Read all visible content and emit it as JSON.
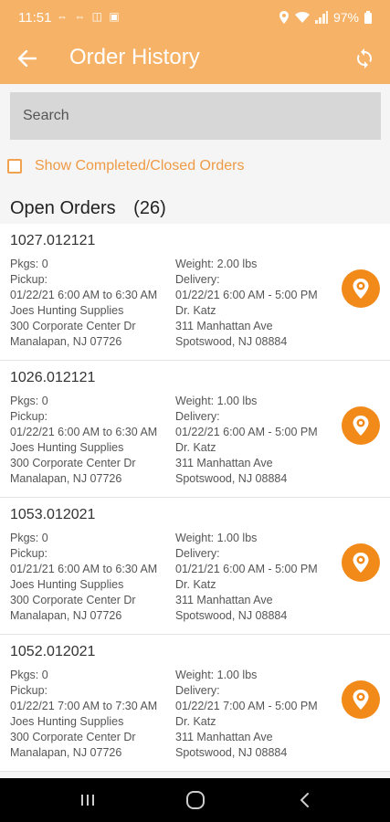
{
  "status_bar": {
    "time": "11:51",
    "left_icons": "⇔ ⇔ ◫ ▣",
    "battery": "97%"
  },
  "header": {
    "title": "Order History",
    "back_icon": "arrow-left",
    "refresh_icon": "refresh"
  },
  "search": {
    "placeholder": "Search"
  },
  "filter": {
    "show_completed_label": "Show Completed/Closed Orders",
    "checked": false
  },
  "section": {
    "title": "Open Orders",
    "count": "(26)"
  },
  "orders": [
    {
      "id": "1027.012121",
      "pkgs": "Pkgs: 0",
      "pickup_label": "Pickup:",
      "pickup_window": "01/22/21 6:00 AM to 6:30 AM",
      "pickup_name": "Joes Hunting Supplies",
      "pickup_street": "300 Corporate Center Dr",
      "pickup_city": "Manalapan, NJ 07726",
      "weight": "Weight: 2.00 lbs",
      "delivery_label": "Delivery:",
      "delivery_window": "01/22/21 6:00 AM - 5:00 PM",
      "delivery_name": "Dr. Katz",
      "delivery_street": "311 Manhattan Ave",
      "delivery_city": "Spotswood, NJ 08884"
    },
    {
      "id": "1026.012121",
      "pkgs": "Pkgs: 0",
      "pickup_label": "Pickup:",
      "pickup_window": "01/22/21 6:00 AM to 6:30 AM",
      "pickup_name": "Joes Hunting Supplies",
      "pickup_street": "300 Corporate Center Dr",
      "pickup_city": "Manalapan, NJ 07726",
      "weight": "Weight: 1.00 lbs",
      "delivery_label": "Delivery:",
      "delivery_window": "01/22/21 6:00 AM - 5:00 PM",
      "delivery_name": "Dr. Katz",
      "delivery_street": "311 Manhattan Ave",
      "delivery_city": "Spotswood, NJ 08884"
    },
    {
      "id": "1053.012021",
      "pkgs": "Pkgs: 0",
      "pickup_label": "Pickup:",
      "pickup_window": "01/21/21 6:00 AM to 6:30 AM",
      "pickup_name": "Joes Hunting Supplies",
      "pickup_street": "300 Corporate Center Dr",
      "pickup_city": "Manalapan, NJ 07726",
      "weight": "Weight: 1.00 lbs",
      "delivery_label": "Delivery:",
      "delivery_window": "01/21/21 6:00 AM - 5:00 PM",
      "delivery_name": "Dr. Katz",
      "delivery_street": "311 Manhattan Ave",
      "delivery_city": "Spotswood, NJ 08884"
    },
    {
      "id": "1052.012021",
      "pkgs": "Pkgs: 0",
      "pickup_label": "Pickup:",
      "pickup_window": "01/22/21 7:00 AM to 7:30 AM",
      "pickup_name": "Joes Hunting Supplies",
      "pickup_street": "300 Corporate Center Dr",
      "pickup_city": "Manalapan, NJ 07726",
      "weight": "Weight: 1.00 lbs",
      "delivery_label": "Delivery:",
      "delivery_window": "01/22/21 7:00 AM - 5:00 PM",
      "delivery_name": "Dr. Katz",
      "delivery_street": "311 Manhattan Ave",
      "delivery_city": "Spotswood, NJ 08884"
    }
  ],
  "colors": {
    "header_bg": "#f6b266",
    "accent": "#f28a1a",
    "checkbox": "#f0a24e"
  },
  "nav": {
    "recent_icon": "recent-apps",
    "home_icon": "home",
    "back_icon": "back"
  }
}
